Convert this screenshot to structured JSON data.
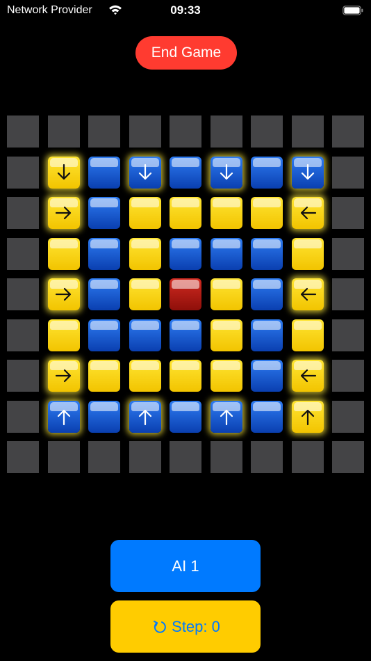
{
  "status_bar": {
    "carrier": "Network Provider",
    "time": "09:33"
  },
  "controls": {
    "end_game": "End Game",
    "ai_button": "AI 1",
    "step_label": "Step: 0"
  },
  "board": {
    "size": 9,
    "legend": {
      "E": "empty",
      "Y": "yellow",
      "B": "blue",
      "R": "red"
    },
    "colors": {
      "empty": "#444446",
      "yellow": "#ffd400",
      "blue": "#1a5ed6",
      "red": "#b81c14",
      "glow": "#ffeb3c"
    },
    "rows": [
      [
        "E",
        "E",
        "E",
        "E",
        "E",
        "E",
        "E",
        "E",
        "E"
      ],
      [
        "E",
        "Y",
        "B",
        "B",
        "B",
        "B",
        "B",
        "B",
        "E"
      ],
      [
        "E",
        "Y",
        "B",
        "Y",
        "Y",
        "Y",
        "Y",
        "Y",
        "E"
      ],
      [
        "E",
        "Y",
        "B",
        "Y",
        "B",
        "B",
        "B",
        "Y",
        "E"
      ],
      [
        "E",
        "Y",
        "B",
        "Y",
        "R",
        "Y",
        "B",
        "Y",
        "E"
      ],
      [
        "E",
        "Y",
        "B",
        "B",
        "B",
        "Y",
        "B",
        "Y",
        "E"
      ],
      [
        "E",
        "Y",
        "Y",
        "Y",
        "Y",
        "Y",
        "B",
        "Y",
        "E"
      ],
      [
        "E",
        "B",
        "B",
        "B",
        "B",
        "B",
        "B",
        "Y",
        "E"
      ],
      [
        "E",
        "E",
        "E",
        "E",
        "E",
        "E",
        "E",
        "E",
        "E"
      ]
    ],
    "arrows": [
      {
        "row": 1,
        "col": 1,
        "dir": "down"
      },
      {
        "row": 1,
        "col": 3,
        "dir": "down"
      },
      {
        "row": 1,
        "col": 5,
        "dir": "down"
      },
      {
        "row": 1,
        "col": 7,
        "dir": "down"
      },
      {
        "row": 2,
        "col": 1,
        "dir": "right"
      },
      {
        "row": 2,
        "col": 7,
        "dir": "left"
      },
      {
        "row": 4,
        "col": 1,
        "dir": "right"
      },
      {
        "row": 4,
        "col": 7,
        "dir": "left"
      },
      {
        "row": 6,
        "col": 1,
        "dir": "right"
      },
      {
        "row": 6,
        "col": 7,
        "dir": "left"
      },
      {
        "row": 7,
        "col": 1,
        "dir": "up"
      },
      {
        "row": 7,
        "col": 3,
        "dir": "up"
      },
      {
        "row": 7,
        "col": 5,
        "dir": "up"
      },
      {
        "row": 7,
        "col": 7,
        "dir": "up"
      }
    ]
  }
}
